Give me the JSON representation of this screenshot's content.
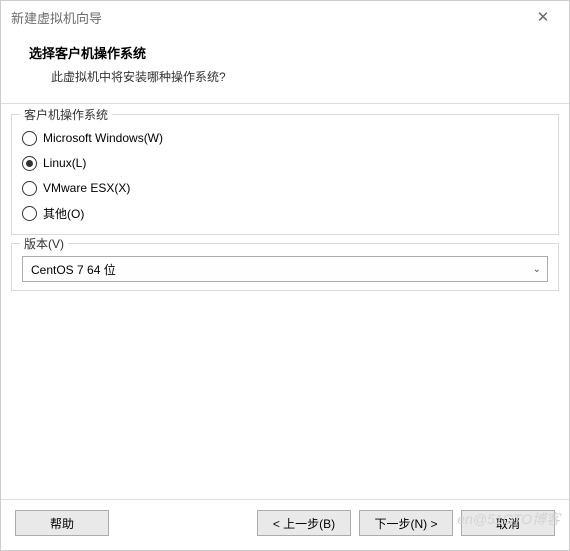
{
  "titlebar": {
    "title": "新建虚拟机向导",
    "close_icon": "✕"
  },
  "header": {
    "title": "选择客户机操作系统",
    "subtitle": "此虚拟机中将安装哪种操作系统?"
  },
  "os_group": {
    "legend": "客户机操作系统",
    "options": [
      {
        "label": "Microsoft Windows(W)",
        "selected": false
      },
      {
        "label": "Linux(L)",
        "selected": true
      },
      {
        "label": "VMware ESX(X)",
        "selected": false
      },
      {
        "label": "其他(O)",
        "selected": false
      }
    ]
  },
  "version_group": {
    "legend": "版本(V)",
    "selected": "CentOS 7 64 位"
  },
  "footer": {
    "help": "帮助",
    "back": "< 上一步(B)",
    "next": "下一步(N) >",
    "cancel": "取消"
  },
  "watermark": "en@51CTO博客"
}
